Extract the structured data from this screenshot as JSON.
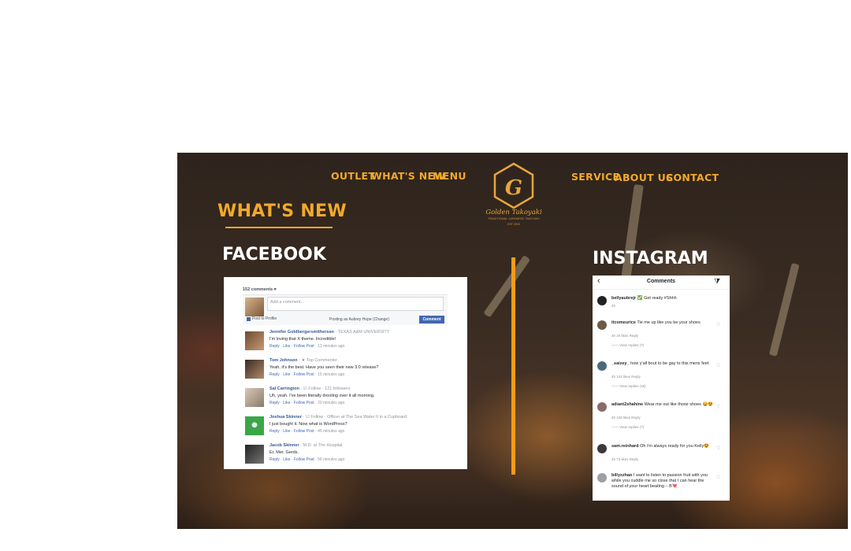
{
  "nav": {
    "left": [
      "OUTLET",
      "WHAT'S NEW",
      "MENU"
    ],
    "right": [
      "SERVICE",
      "ABOUT US",
      "CONTACT"
    ]
  },
  "logo": {
    "letter": "G",
    "name": "Golden Takoyaki",
    "tagline": "TRADITIONAL JAPANESE TAKOYAKI",
    "est": "EST 2015"
  },
  "section_title": "WHAT'S NEW",
  "facebook": {
    "heading": "FACEBOOK",
    "comment_count": "152 comments ▾",
    "composer": {
      "placeholder": "Add a comment...",
      "post_to_profile": "Post to Profile",
      "posting_as": "Posting as Aubrey Hope (Change)",
      "button": "Comment"
    },
    "comments": [
      {
        "name": "Jennifer Goldbergersmithersen",
        "meta": "· TEXAS A&M UNIVERSITY",
        "text": "I'm loving that X theme. Incredible!",
        "actions": "Reply · Like · Follow Post",
        "time": "· 13 minutes ago"
      },
      {
        "name": "Tom Johnson",
        "meta": "· ★ Top Commenter",
        "text": "Yeah, it's the best. Have you seen their new 3.0 release?",
        "actions": "Reply · Like · Follow Post",
        "time": "· 15 minutes ago"
      },
      {
        "name": "Sal Carrington",
        "meta": "· ☑ Follow · 121 followers",
        "text": "Uh, yeah. I've been literally drooling over it all morning.",
        "actions": "Reply · Like · Follow Post",
        "time": "· 20 minutes ago"
      },
      {
        "name": "Joshua Skinner",
        "meta": "· ☑ Follow · Officer at The Sea Water II in a Cupboard",
        "text": "I just bought it. Now what is WordPress?",
        "actions": "Reply · Like · Follow Post",
        "time": "· 45 minutes ago"
      },
      {
        "name": "Jacob Skinner",
        "meta": "· M.D. at The Hospital",
        "text": "Er, Mer. Gerds.",
        "actions": "Reply · Like · Follow Post",
        "time": "· 56 minutes ago"
      }
    ]
  },
  "instagram": {
    "heading": "INSTAGRAM",
    "header_title": "Comments",
    "comments": [
      {
        "user": "bellyaubrejr",
        "text": "✅ Get ready #Shhh",
        "meta": "4h",
        "replies": ""
      },
      {
        "user": "itcomeurice",
        "text": "Tie me up like you be your shoes",
        "meta": "4h    20 likes    Reply",
        "replies": "—— View replies (7)"
      },
      {
        "user": "_saizey_",
        "text": "how y'all bout to be gay to this mens feet",
        "meta": "4h    142 likes    Reply",
        "replies": "—— View replies (18)"
      },
      {
        "user": "adiant2shahine",
        "text": "Wear me out like those shoes 😂😍",
        "meta": "4h    128 likes    Reply",
        "replies": "—— View replies (7)"
      },
      {
        "user": "sam.reinhard",
        "text": "Oh i'm always ready for you Kelly😍",
        "meta": "4h    73 likes    Reply",
        "replies": ""
      },
      {
        "user": "billyzzhao",
        "text": "I want to listen to passion fruit with you while you cuddle me so close that I can hear the sound of your heart beating – B💘",
        "meta": "",
        "replies": ""
      }
    ]
  },
  "colors": {
    "accent": "#f2a92b",
    "divider": "#f59c16",
    "facebook_blue": "#4267b2"
  }
}
